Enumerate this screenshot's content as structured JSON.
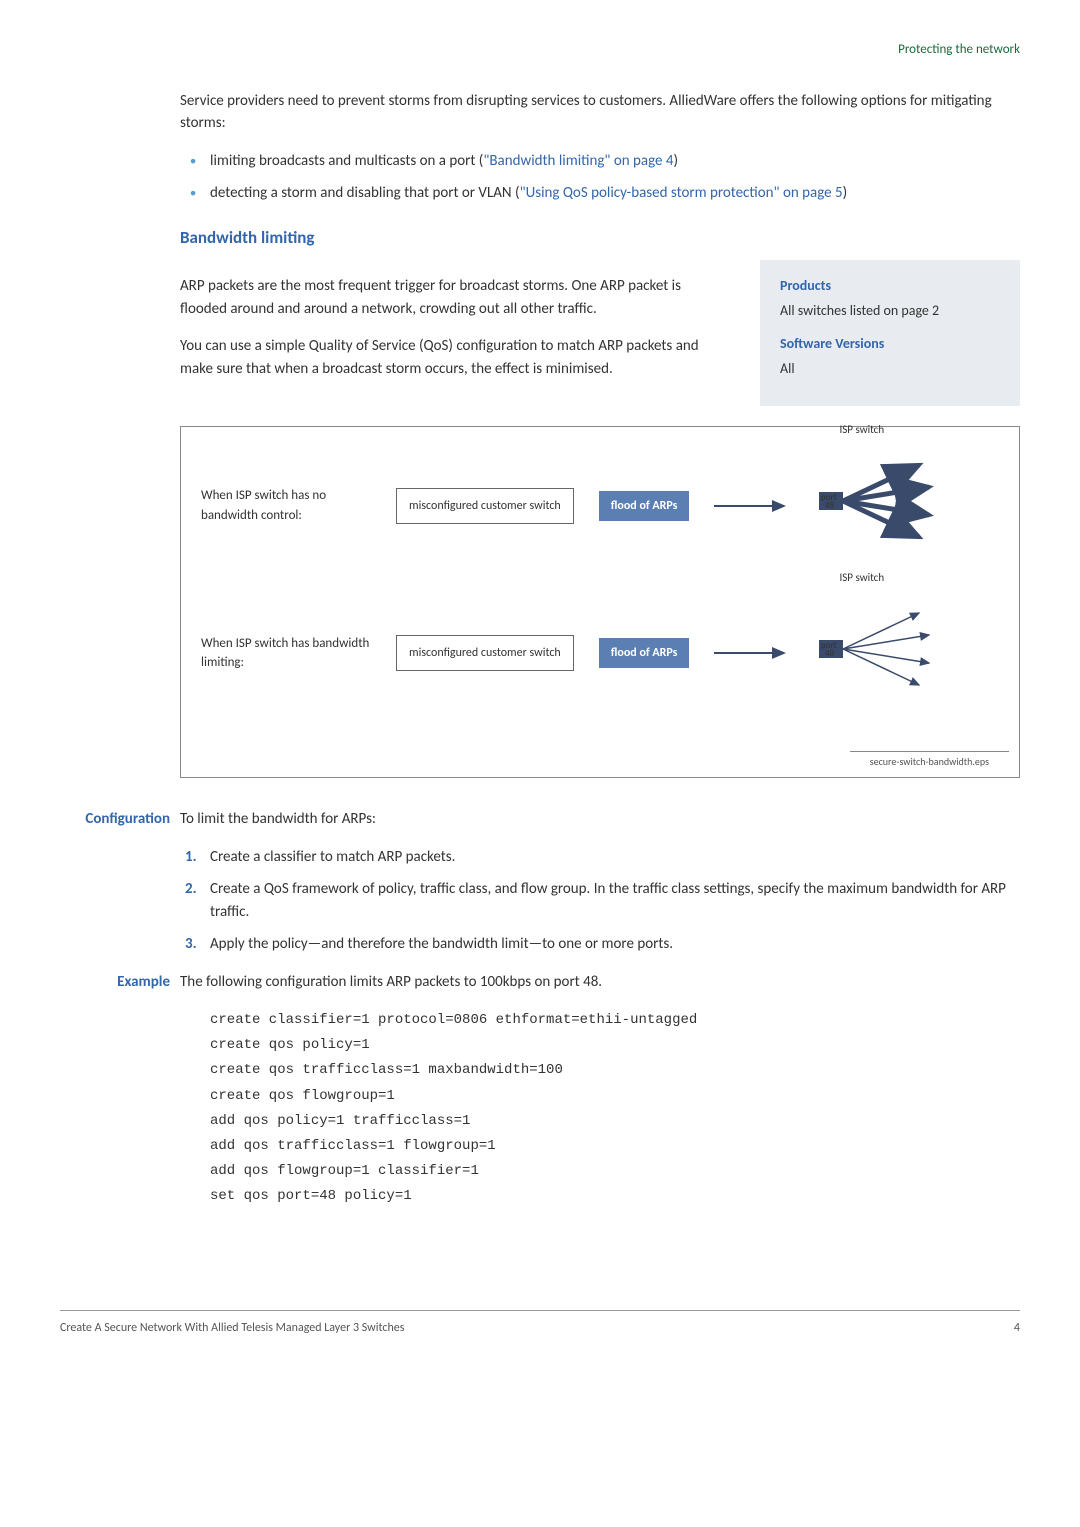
{
  "header": {
    "section_label": "Protecting the network"
  },
  "intro": {
    "text": "Service providers need to prevent storms from disrupting services to customers. AlliedWare offers the following options for mitigating storms:"
  },
  "bullets": [
    {
      "text_before": "limiting broadcasts and multicasts on a port (",
      "link": "\"Bandwidth limiting\" on page 4",
      "text_after": ")"
    },
    {
      "text_before": "detecting a storm and disabling that port or VLAN (",
      "link": "\"Using QoS policy-based storm protection\" on page 5",
      "text_after": ")"
    }
  ],
  "section": {
    "heading": "Bandwidth limiting",
    "para1": "ARP packets are the most frequent trigger for broadcast storms. One ARP packet is flooded around and around a network, crowding out all other traffic.",
    "para2": "You can use a simple Quality of Service (QoS) configuration to match ARP packets and make sure that when a broadcast storm occurs, the effect is minimised."
  },
  "infobox": {
    "title1": "Products",
    "text1": "All switches listed on page 2",
    "title2": "Software Versions",
    "text2": "All"
  },
  "diagram": {
    "row1_label": "When ISP switch has no bandwidth control:",
    "row2_label": "When ISP switch has bandwidth limiting:",
    "switch_label": "misconfigured customer switch",
    "flood_label": "flood of ARPs",
    "isp_label": "ISP switch",
    "port_label": "port 48",
    "filename": "secure-switch-bandwidth.eps"
  },
  "configuration": {
    "label": "Configuration",
    "intro": "To limit the bandwidth for ARPs:",
    "steps": [
      "Create a classifier to match ARP packets.",
      "Create a QoS framework of policy, traffic class, and flow group. In the traffic class settings, specify the maximum bandwidth for ARP traffic.",
      "Apply the policy—and therefore the bandwidth limit—to one or more ports."
    ]
  },
  "example": {
    "label": "Example",
    "intro": "The following configuration limits ARP packets to 100kbps on port 48.",
    "code": "create classifier=1 protocol=0806 ethformat=ethii-untagged\ncreate qos policy=1\ncreate qos trafficclass=1 maxbandwidth=100\ncreate qos flowgroup=1\nadd qos policy=1 trafficclass=1\nadd qos trafficclass=1 flowgroup=1\nadd qos flowgroup=1 classifier=1\nset qos port=48 policy=1"
  },
  "footer": {
    "left": "Create A Secure Network With Allied Telesis Managed Layer 3 Switches",
    "right": "4"
  }
}
